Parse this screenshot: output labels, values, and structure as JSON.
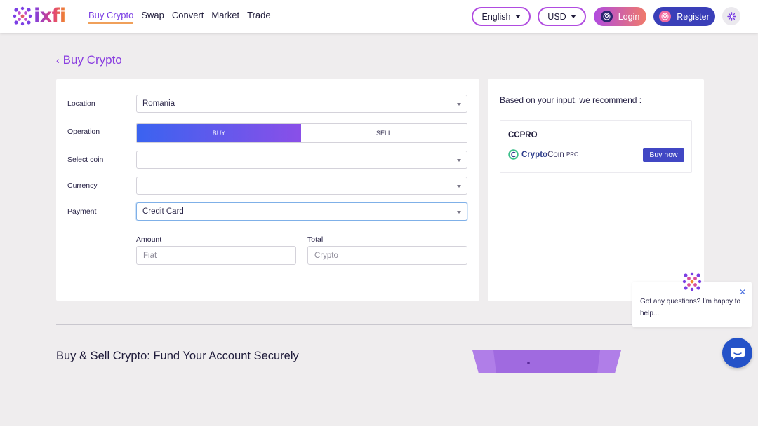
{
  "header": {
    "brand": "ixfi",
    "nav": [
      {
        "label": "Buy Crypto",
        "active": true
      },
      {
        "label": "Swap",
        "active": false
      },
      {
        "label": "Convert",
        "active": false
      },
      {
        "label": "Market",
        "active": false
      },
      {
        "label": "Trade",
        "active": false
      }
    ],
    "language": "English",
    "currency": "USD",
    "login_label": "Login",
    "register_label": "Register"
  },
  "page": {
    "back_title": "Buy Crypto"
  },
  "form": {
    "location_label": "Location",
    "location_value": "Romania",
    "operation_label": "Operation",
    "buy_label": "BUY",
    "sell_label": "SELL",
    "select_coin_label": "Select coin",
    "select_coin_value": "",
    "currency_label": "Currency",
    "currency_value": "",
    "payment_label": "Payment",
    "payment_value": "Credit Card",
    "amount_label": "Amount",
    "amount_placeholder": "Fiat",
    "total_label": "Total",
    "total_placeholder": "Crypto"
  },
  "recommend": {
    "title": "Based on your input, we recommend :",
    "provider_name": "CCPRO",
    "provider_logo_main": "Crypto",
    "provider_logo_second": "Coin",
    "provider_logo_suffix": ".PRO",
    "buy_now_label": "Buy now"
  },
  "section": {
    "heading": "Buy & Sell Crypto: Fund Your Account Securely"
  },
  "chat": {
    "message": "Got any questions? I'm happy to help..."
  },
  "colors": {
    "accent": "#7b3fe4",
    "register": "#3a3fb8",
    "buy_now": "#4147c4",
    "chat_launcher": "#2452c8"
  }
}
